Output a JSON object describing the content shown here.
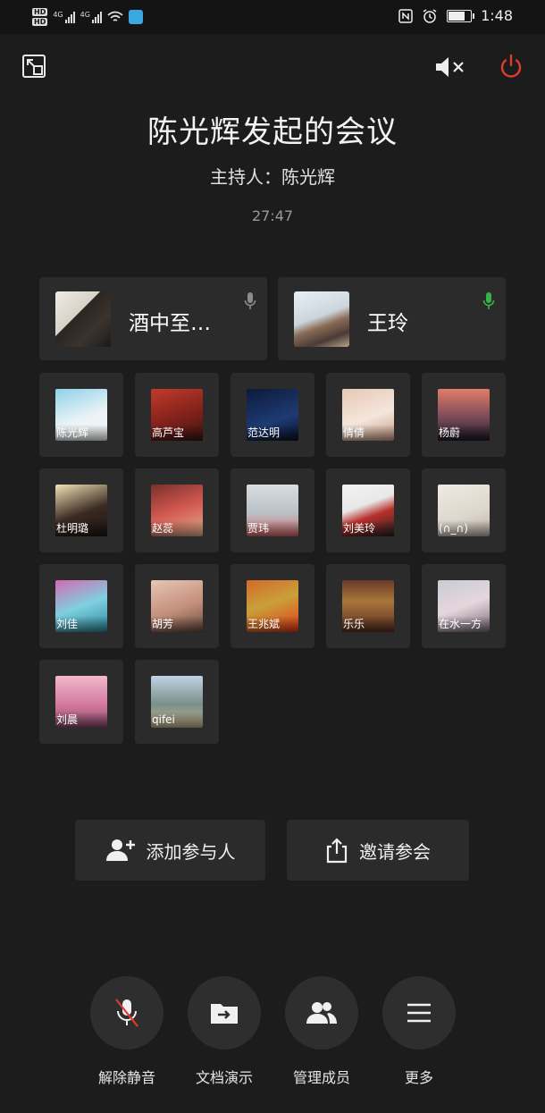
{
  "status_bar": {
    "hd1": "HD",
    "hd2": "HD",
    "net1": "4G",
    "net2": "4G",
    "time": "1:48"
  },
  "meeting": {
    "title": "陈光辉发起的会议",
    "host": "主持人：陈光辉",
    "timer": "27:47"
  },
  "speakers": [
    {
      "name": "酒中至…",
      "mic": "mic-icon",
      "mic_color": "#8a8a8a"
    },
    {
      "name": "王玲",
      "mic": "mic-active-icon",
      "mic_color": "#35b24a"
    }
  ],
  "participants": [
    {
      "name": "陈光辉"
    },
    {
      "name": "高芦宝"
    },
    {
      "name": "范达明"
    },
    {
      "name": "倩倩"
    },
    {
      "name": "杨蔚"
    },
    {
      "name": "杜明璐"
    },
    {
      "name": "赵蕊"
    },
    {
      "name": "贾玮"
    },
    {
      "name": "刘美玲"
    },
    {
      "name": "(∩_∩)"
    },
    {
      "name": "刘佳"
    },
    {
      "name": "胡芳"
    },
    {
      "name": "王兆斌"
    },
    {
      "name": "乐乐"
    },
    {
      "name": "在水一方"
    },
    {
      "name": "刘晨"
    },
    {
      "name": "qifei"
    }
  ],
  "actions": {
    "add_participant": "添加参与人",
    "invite": "邀请参会"
  },
  "controls": {
    "unmute": "解除静音",
    "share_doc": "文档演示",
    "manage_members": "管理成员",
    "more": "更多"
  },
  "colors": {
    "background": "#1c1c1c",
    "card": "#2b2b2b",
    "power": "#e03a2f",
    "mic_active": "#35b24a"
  }
}
